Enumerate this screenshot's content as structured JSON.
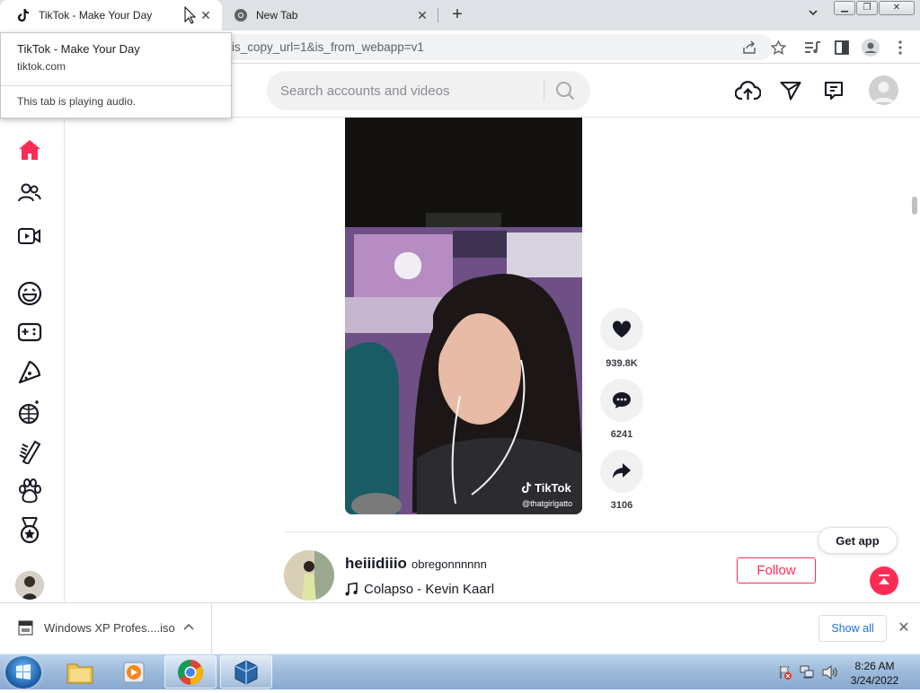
{
  "browser": {
    "tabs": [
      {
        "title": "TikTok - Make Your Day",
        "active": true
      },
      {
        "title": "New Tab",
        "active": false
      }
    ],
    "new_tab_symbol": "+",
    "address_url": "is_copy_url=1&is_from_webapp=v1",
    "hover_card": {
      "title": "TikTok - Make Your Day",
      "domain": "tiktok.com",
      "audio_status": "This tab is playing audio."
    },
    "toolbar_icons": [
      "share-icon",
      "star-icon",
      "media-control-icon",
      "side-panel-icon",
      "profile-icon",
      "menu-icon"
    ]
  },
  "tiktok": {
    "search_placeholder": "Search accounts and videos",
    "header_icons": [
      "upload-icon",
      "messages-icon",
      "inbox-icon",
      "user-avatar"
    ],
    "sidebar_icons": [
      "home-icon",
      "following-icon",
      "live-icon",
      "comedy-icon",
      "gaming-icon",
      "food-icon",
      "dance-icon",
      "beauty-icon",
      "animals-icon",
      "sports-icon",
      "account-avatar"
    ],
    "video": {
      "watermark_logo": "TikTok",
      "watermark_handle": "@thatgirlgatto"
    },
    "actions": {
      "likes": "939.8K",
      "comments": "6241",
      "shares": "3106"
    },
    "next_post": {
      "username": "heiiidiiio",
      "nickname": "obregonnnnnn",
      "music": "Colapso - Kevin Kaarl",
      "follow_label": "Follow"
    },
    "get_app_label": "Get app",
    "accent_color": "#fe2c55"
  },
  "downloads": {
    "file_name": "Windows XP Profes....iso",
    "show_all_label": "Show all"
  },
  "taskbar": {
    "apps": [
      "file-explorer",
      "media-player",
      "chrome",
      "virtualbox"
    ],
    "time": "8:26 AM",
    "date": "3/24/2022"
  }
}
